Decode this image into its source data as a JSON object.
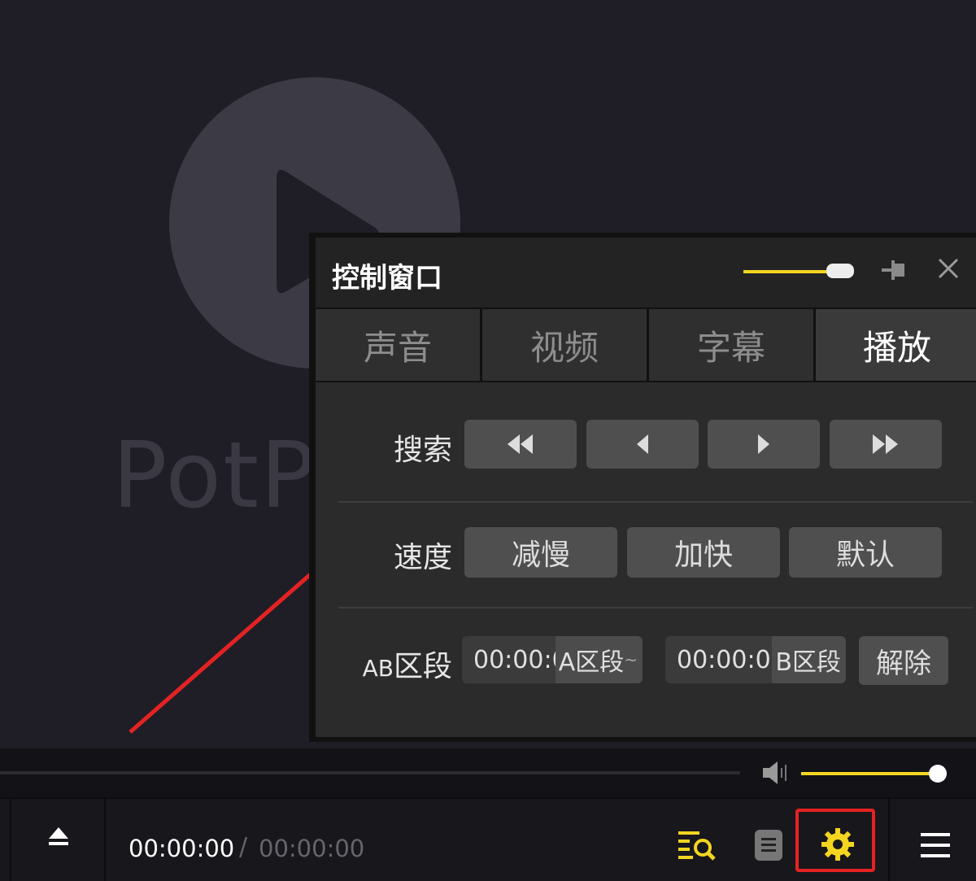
{
  "background": {
    "logo_text": "PotP",
    "accent": "#f4d520",
    "highlight_color": "#e52222",
    "arrow_color": "#e52222"
  },
  "control_window": {
    "title": "控制窗口",
    "tabs": [
      {
        "label": "声音",
        "active": false
      },
      {
        "label": "视频",
        "active": false
      },
      {
        "label": "字幕",
        "active": false
      },
      {
        "label": "播放",
        "active": true
      }
    ],
    "search": {
      "label": "搜索",
      "buttons": [
        "fast-rewind-icon",
        "step-back-icon",
        "step-forward-icon",
        "fast-forward-icon"
      ]
    },
    "speed": {
      "label": "速度",
      "slower": "减慢",
      "faster": "加快",
      "default": "默认"
    },
    "ab": {
      "label_prefix": "AB",
      "label_suffix": "区段",
      "a_time": "00:00:00",
      "a_tag": "A区段",
      "a_tilde": "~",
      "b_time": "00:00:00",
      "b_tag": "B区段",
      "clear": "解除"
    }
  },
  "player": {
    "current_time": "00:00:00",
    "separator": "/",
    "total_time": "00:00:00",
    "volume_level": 1.0
  }
}
